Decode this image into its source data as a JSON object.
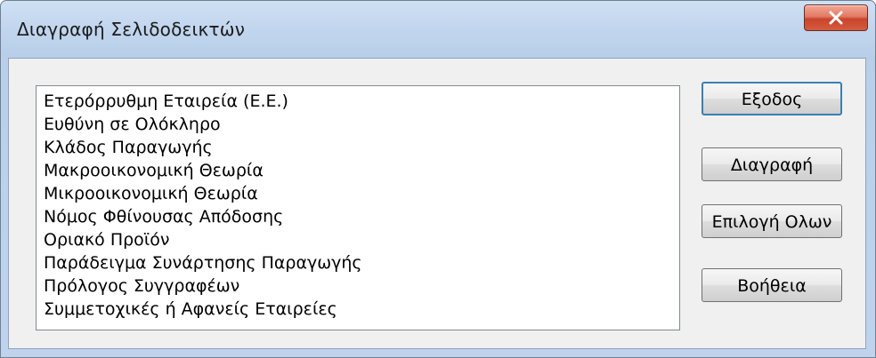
{
  "window": {
    "title": "Διαγραφή Σελιδοδεικτών",
    "close_icon": "close-x-icon"
  },
  "bookmarks": [
    "Ετερόρρυθμη Εταιρεία (Ε.Ε.)",
    "Ευθύνη σε Ολόκληρο",
    "Κλάδος Παραγωγής",
    "Μακροοικονομική Θεωρία",
    "Μικροοικονομική Θεωρία",
    "Νόμος Φθίνουσας Απόδοσης",
    "Οριακό Προϊόν",
    "Παράδειγμα Συνάρτησης Παραγωγής",
    "Πρόλογος Συγγραφέων",
    "Συμμετοχικές ή Αφανείς Εταιρείες"
  ],
  "buttons": {
    "exit": "Εξοδος",
    "delete": "Διαγραφή",
    "select_all": "Επιλογή Ολων",
    "help": "Βοήθεια"
  }
}
